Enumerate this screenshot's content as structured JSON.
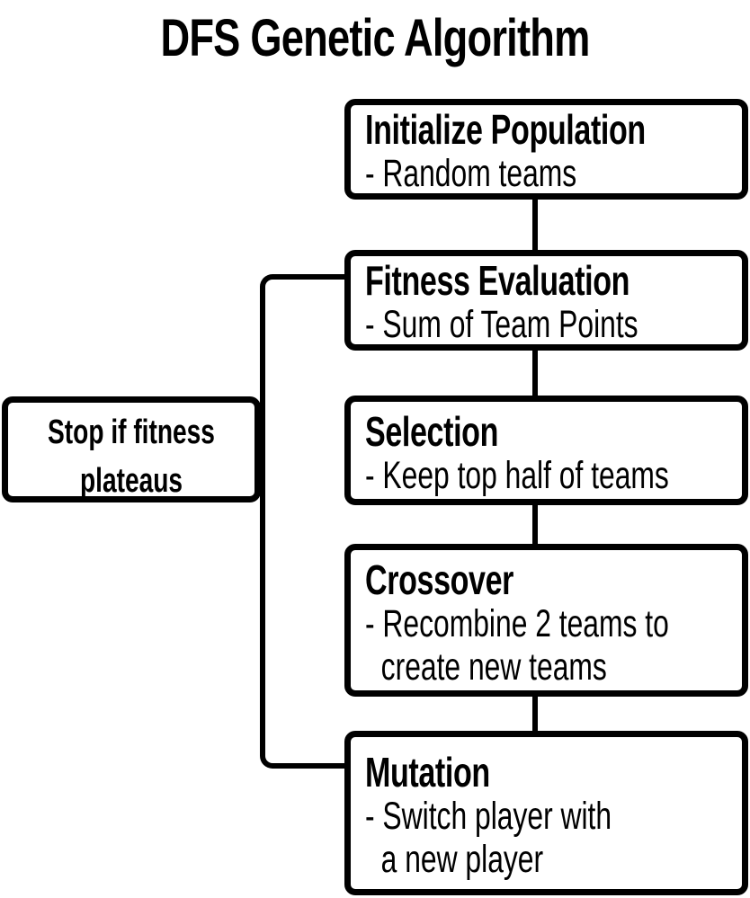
{
  "title": "DFS Genetic Algorithm",
  "steps": [
    {
      "title": "Initialize Population",
      "desc": "- Random teams"
    },
    {
      "title": "Fitness Evaluation",
      "desc": "- Sum of Team Points"
    },
    {
      "title": "Selection",
      "desc": "- Keep top half of teams"
    },
    {
      "title": "Crossover",
      "desc": "- Recombine 2 teams to\n  create new teams"
    },
    {
      "title": "Mutation",
      "desc": "- Switch player with\n  a new player"
    }
  ],
  "stop_condition": {
    "line1": "Stop if fitness",
    "line2": "plateaus"
  },
  "colors": {
    "stroke": "#000000",
    "background": "#ffffff"
  }
}
